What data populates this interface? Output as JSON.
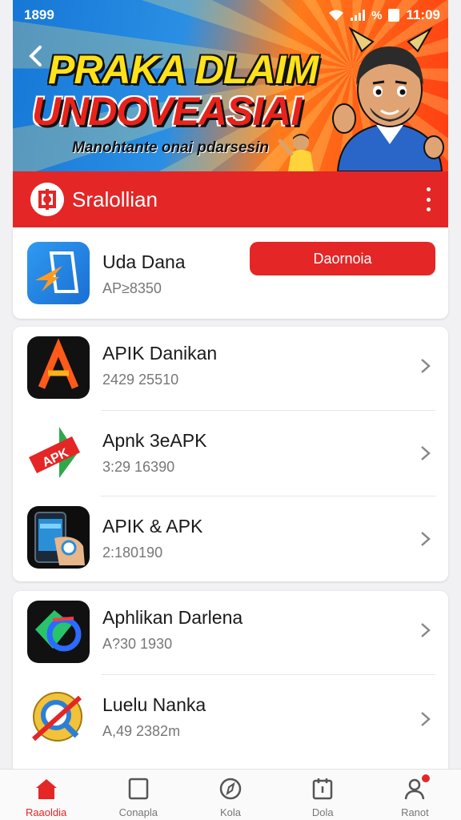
{
  "status_bar": {
    "time_left": "1899",
    "time_right": "11:09"
  },
  "banner": {
    "headline_line1": "PRAKA DLAIM",
    "headline_line2": "UNDOVEASIAI",
    "subtitle": "Manohtante onai pdarsesin"
  },
  "app_header": {
    "title": "Sralollian"
  },
  "featured_app": {
    "name": "Uda Dana",
    "meta": "AP≥8350",
    "download_label": "Daornoia"
  },
  "app_list": [
    {
      "name": "APIK Danikan",
      "meta": "2429 25510",
      "icon": "apk-a-logo-icon"
    },
    {
      "name": "Apnk 3eAPK",
      "meta": "3:29 16390",
      "icon": "apk-ribbon-icon"
    },
    {
      "name": "APIK & APK",
      "meta": "2:180190",
      "icon": "phone-hand-icon"
    },
    {
      "name": "Aphlikan Darlena",
      "meta": "A?30 1930",
      "icon": "green-circle-logo-icon"
    },
    {
      "name": "Luelu Nanka",
      "meta": "A,49 2382m",
      "icon": "search-badge-icon"
    }
  ],
  "bottom_nav": [
    {
      "label": "Raaoldia",
      "icon": "home-icon",
      "active": true
    },
    {
      "label": "Conapla",
      "icon": "square-icon",
      "active": false
    },
    {
      "label": "Kola",
      "icon": "compass-icon",
      "active": false
    },
    {
      "label": "Dola",
      "icon": "calendar-icon",
      "active": false
    },
    {
      "label": "Ranot",
      "icon": "profile-icon",
      "active": false,
      "badge": true
    }
  ],
  "colors": {
    "accent_red": "#e42626",
    "banner_yellow": "#ffe21a",
    "text_gray": "#777777"
  }
}
